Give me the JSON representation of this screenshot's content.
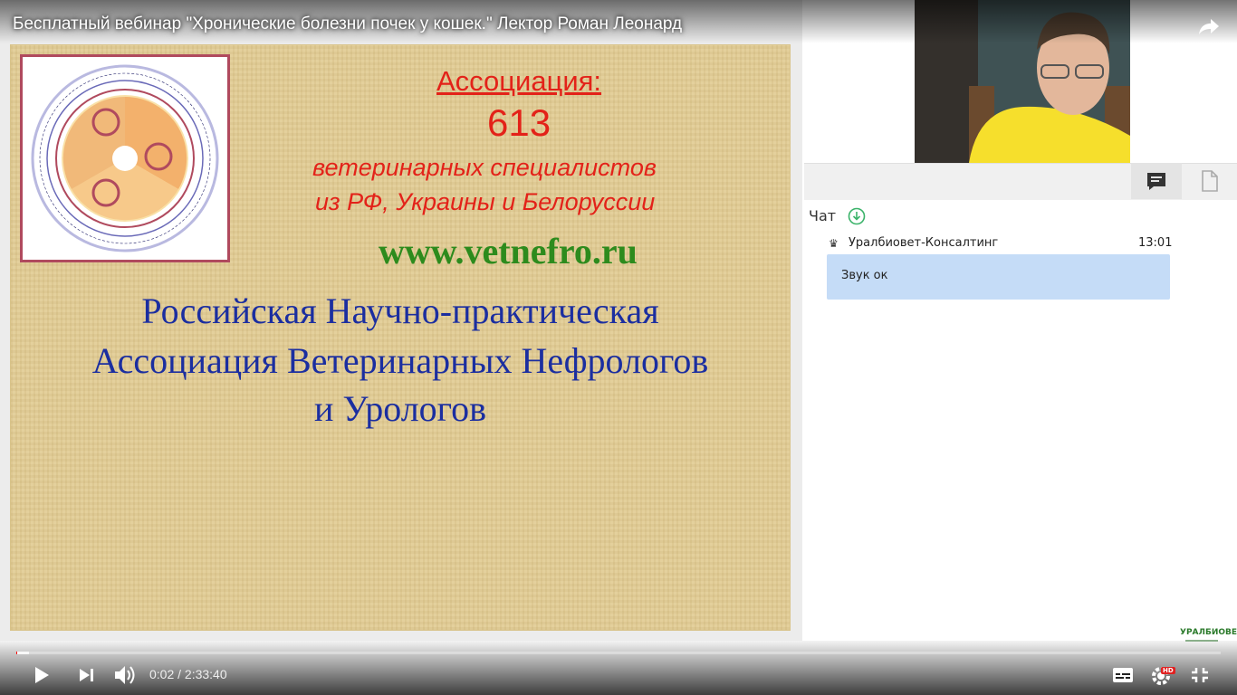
{
  "video": {
    "title": "Бесплатный вебинар \"Хронические болезни почек у кошек.\" Лектор Роман Леонард",
    "current_time": "0:02",
    "duration": "2:33:40",
    "time_display": "0:02 / 2:33:40",
    "progress": 0.0002,
    "quality_badge": "HD"
  },
  "slide": {
    "logo_text": "Научно-практическая Ассоциация Ветеринарных Нефрологов и Урологов · Scientific and Practical Association of Veterinary Nephrologists and Urologists",
    "assoc_title": "Ассоциация:",
    "assoc_count": "613",
    "assoc_line1": "ветеринарных специалистов",
    "assoc_line2": "из РФ, Украины и Белоруссии",
    "website": "www.vetnefro.ru",
    "org_line1": "Российская Научно-практическая",
    "org_line2": "Ассоциация Ветеринарных Нефрологов",
    "org_line3": "и Урологов"
  },
  "chat": {
    "label": "Чат",
    "messages": [
      {
        "author": "Уралбиовет-Консалтинг",
        "time": "13:01",
        "text": "Звук ок"
      }
    ]
  },
  "brand": {
    "name": "УРАЛБИОВЕТ"
  },
  "colors": {
    "slide_bg": "#e2cd95",
    "red_text": "#e32219",
    "green_text": "#2d8b1d",
    "blue_text": "#1b2ea0",
    "bubble": "#c5dcf7",
    "progress": "#ff0000"
  },
  "icons": [
    "share-icon",
    "chat-icon",
    "document-icon",
    "download-icon",
    "crown-icon",
    "play-icon",
    "next-icon",
    "volume-icon",
    "subtitles-icon",
    "settings-icon",
    "fullscreen-icon"
  ]
}
